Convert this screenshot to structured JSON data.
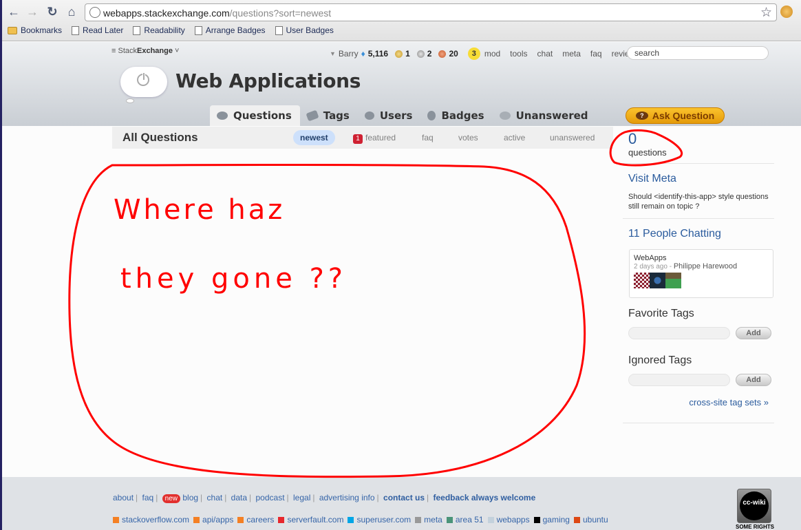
{
  "browser": {
    "url_host": "webapps.stackexchange.com",
    "url_path": "/questions?sort=newest",
    "bookmarks": [
      {
        "label": "Bookmarks",
        "icon": "folder-icon"
      },
      {
        "label": "Read Later",
        "icon": "page-icon"
      },
      {
        "label": "Readability",
        "icon": "page-icon"
      },
      {
        "label": "Arrange Badges",
        "icon": "page-icon"
      },
      {
        "label": "User Badges",
        "icon": "page-icon"
      }
    ]
  },
  "topbar": {
    "network_prefix": "Stack",
    "network_bold": "Exchange",
    "username": "Barry",
    "reputation": "5,116",
    "gold_badges": "1",
    "silver_badges": "2",
    "bronze_badges": "20",
    "mod_flags": "3",
    "links": [
      "mod",
      "tools",
      "chat",
      "meta",
      "faq",
      "review"
    ],
    "search_placeholder": "search"
  },
  "site": {
    "title": "Web Applications"
  },
  "nav": {
    "tabs": [
      {
        "label": "Questions",
        "active": true
      },
      {
        "label": "Tags"
      },
      {
        "label": "Users"
      },
      {
        "label": "Badges"
      },
      {
        "label": "Unanswered"
      }
    ],
    "ask_label": "Ask Question"
  },
  "subheader": {
    "title": "All Questions",
    "sorts": [
      "newest",
      "featured",
      "faq",
      "votes",
      "active",
      "unanswered"
    ],
    "featured_count": "1",
    "active_sort": "newest"
  },
  "sidebar": {
    "question_count": "0",
    "question_label": "questions",
    "meta_heading": "Visit Meta",
    "meta_question": "Should <identify-this-app> style questions still remain on topic ?",
    "chat_heading": "11 People Chatting",
    "chat_room": "WebApps",
    "chat_when": "2 days ago",
    "chat_sep": " - ",
    "chat_user": "Philippe Harewood",
    "fav_heading": "Favorite Tags",
    "ignored_heading": "Ignored Tags",
    "add_label": "Add",
    "cross_site": "cross-site tag sets »"
  },
  "annotation": {
    "line1": "Where haz",
    "line2": "they gone ??"
  },
  "footer": {
    "links": [
      "about",
      "faq",
      "blog",
      "chat",
      "data",
      "podcast",
      "legal",
      "advertising info"
    ],
    "bold_links": [
      "contact us",
      "feedback always welcome"
    ],
    "new_badge": "new",
    "sites": [
      {
        "label": "stackoverflow.com",
        "color": "#f48024"
      },
      {
        "label": "api/apps",
        "color": "#f48024"
      },
      {
        "label": "careers",
        "color": "#f48024"
      },
      {
        "label": "serverfault.com",
        "color": "#e7272d"
      },
      {
        "label": "superuser.com",
        "color": "#00a6e6"
      },
      {
        "label": "meta",
        "color": "#999999"
      },
      {
        "label": "area 51",
        "color": "#4a9479"
      },
      {
        "label": "webapps",
        "color": "#c3d1dc"
      },
      {
        "label": "gaming",
        "color": "#000000"
      },
      {
        "label": "ubuntu",
        "color": "#dd4814"
      }
    ],
    "cc_text": "cc-wiki",
    "cc_caption": "SOME RIGHTS"
  },
  "colors": {
    "link": "#2a5b9d",
    "ask_button": "#f5ae1b",
    "scribble": "#ff0000"
  }
}
